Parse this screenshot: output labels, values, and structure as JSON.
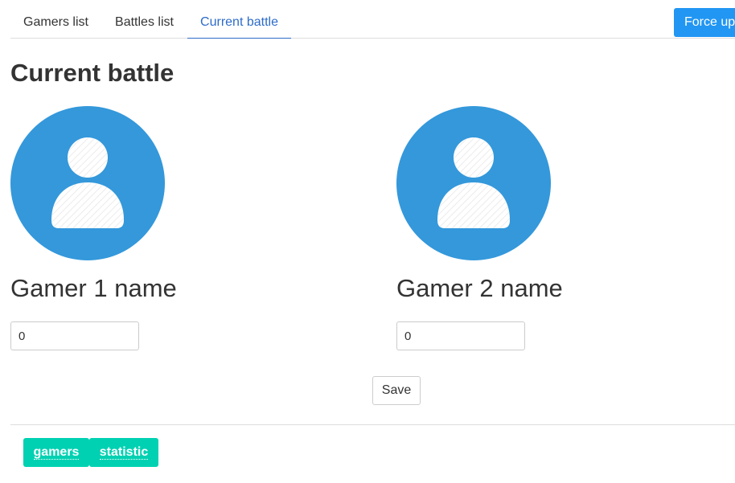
{
  "nav": {
    "tabs": [
      {
        "label": "Gamers list",
        "active": false
      },
      {
        "label": "Battles list",
        "active": false
      },
      {
        "label": "Current battle",
        "active": true
      }
    ],
    "force_update_label": "Force update",
    "active_color": "#2d6cc9",
    "button_color": "#2196f3"
  },
  "page": {
    "title": "Current battle"
  },
  "gamers": [
    {
      "name": "Gamer 1 name",
      "score": "0",
      "avatar_icon": "user-avatar-icon"
    },
    {
      "name": "Gamer 2 name",
      "score": "0",
      "avatar_icon": "user-avatar-icon"
    }
  ],
  "avatar_color": "#3498db",
  "save_label": "Save",
  "footer": {
    "tags": [
      {
        "label": "gamers"
      },
      {
        "label": "statistic"
      }
    ],
    "tag_color": "#00d1b2"
  }
}
